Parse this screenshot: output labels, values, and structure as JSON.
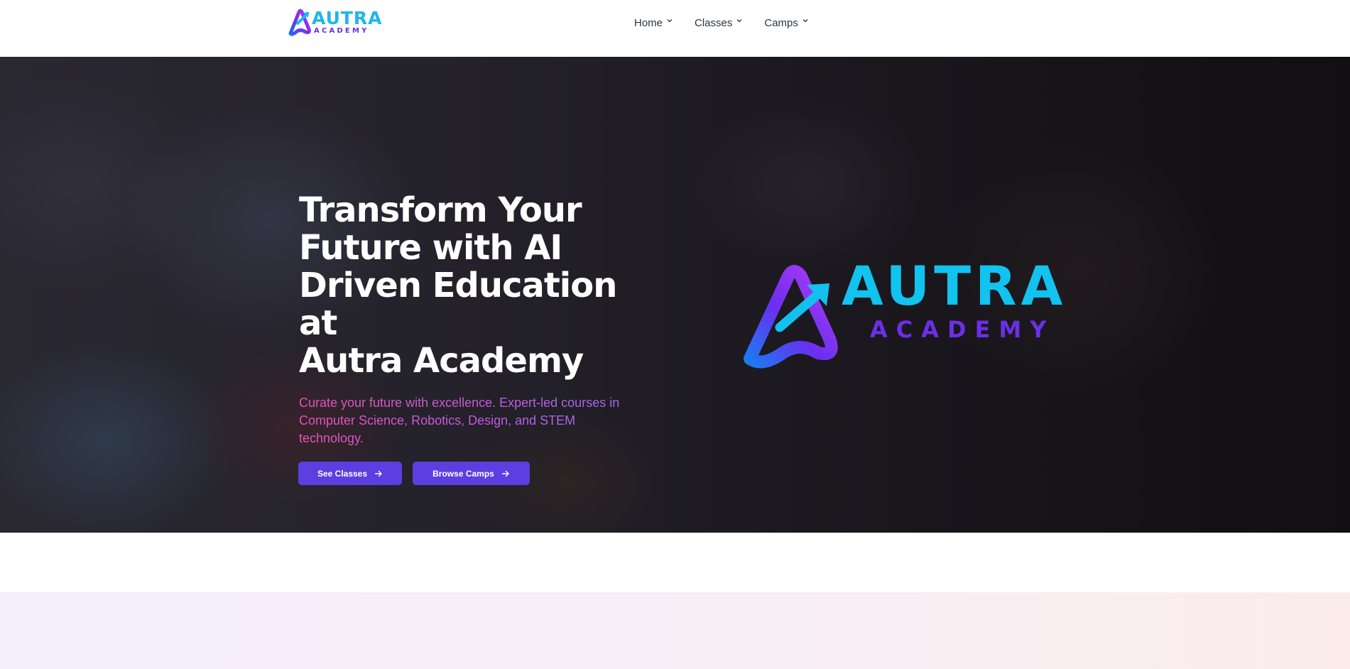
{
  "brand": {
    "logo_word": "AUTRA",
    "logo_tagline": "ACADEMY",
    "colors": {
      "cyan": "#12c2ef",
      "purple": "#6b2fe6",
      "button": "#5b3fe0"
    }
  },
  "nav": {
    "items": [
      {
        "label": "Home",
        "icon": "chevron-down-icon"
      },
      {
        "label": "Classes",
        "icon": "chevron-down-icon"
      },
      {
        "label": "Camps",
        "icon": "chevron-down-icon"
      }
    ]
  },
  "hero": {
    "title_lines": [
      "Transform Your",
      "Future with AI",
      "Driven Education at",
      "Autra Academy"
    ],
    "subtitle": "Curate your future with excellence. Expert-led courses in Computer Science, Robotics, Design, and STEM technology.",
    "buttons": [
      {
        "label": "See Classes",
        "icon": "arrow-right-icon"
      },
      {
        "label": "Browse Camps",
        "icon": "arrow-right-icon"
      }
    ]
  }
}
